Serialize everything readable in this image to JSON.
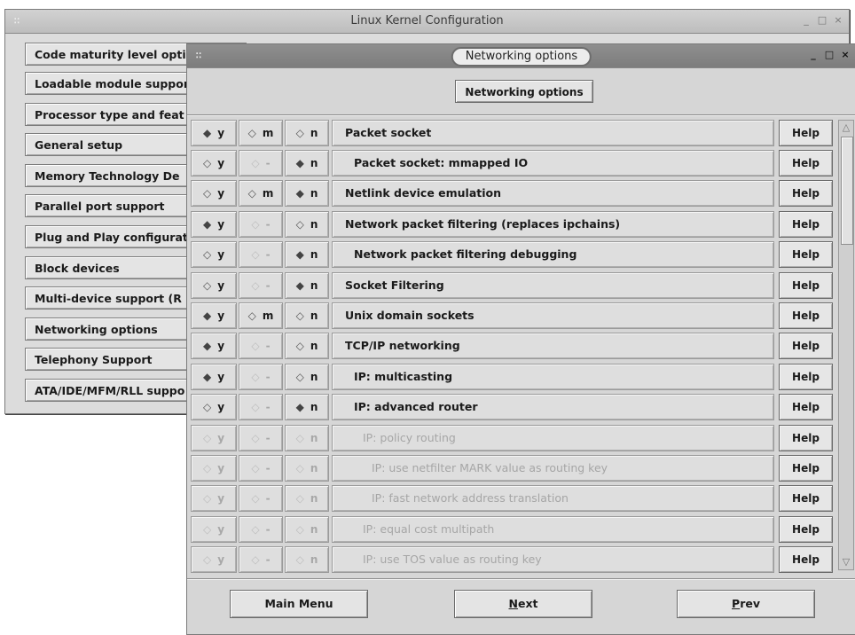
{
  "main_window": {
    "title": "Linux Kernel Configuration",
    "menu_glyph": "∷",
    "controls": [
      "_",
      "□",
      "×"
    ],
    "menu_items": [
      "Code maturity level opti",
      "Loadable module suppor",
      "Processor type and feat",
      "General setup",
      "Memory Technology De",
      "Parallel port support",
      "Plug and Play configurat",
      "Block devices",
      "Multi-device support (R",
      "Networking options",
      "Telephony Support",
      "ATA/IDE/MFM/RLL suppo"
    ]
  },
  "dialog": {
    "title": "Networking options",
    "menu_glyph": "∷",
    "controls": [
      "_",
      "□",
      "×"
    ],
    "header_button": "Networking options",
    "radio_glyph": "◆",
    "help_label": "Help",
    "options": [
      {
        "label": "Packet socket",
        "y": "y",
        "m": "m",
        "n": "n",
        "selected": "y",
        "m_available": true,
        "enabled": true,
        "indent": 0
      },
      {
        "label": "Packet socket: mmapped IO",
        "y": "y",
        "m": "-",
        "n": "n",
        "selected": "n",
        "m_available": false,
        "enabled": true,
        "indent": 1
      },
      {
        "label": "Netlink device emulation",
        "y": "y",
        "m": "m",
        "n": "n",
        "selected": "n",
        "m_available": true,
        "enabled": true,
        "indent": 0
      },
      {
        "label": "Network packet filtering (replaces ipchains)",
        "y": "y",
        "m": "-",
        "n": "n",
        "selected": "y",
        "m_available": false,
        "enabled": true,
        "indent": 0
      },
      {
        "label": "Network packet filtering debugging",
        "y": "y",
        "m": "-",
        "n": "n",
        "selected": "n",
        "m_available": false,
        "enabled": true,
        "indent": 1
      },
      {
        "label": "Socket Filtering",
        "y": "y",
        "m": "-",
        "n": "n",
        "selected": "n",
        "m_available": false,
        "enabled": true,
        "indent": 0
      },
      {
        "label": "Unix domain sockets",
        "y": "y",
        "m": "m",
        "n": "n",
        "selected": "y",
        "m_available": true,
        "enabled": true,
        "indent": 0
      },
      {
        "label": "TCP/IP networking",
        "y": "y",
        "m": "-",
        "n": "n",
        "selected": "y",
        "m_available": false,
        "enabled": true,
        "indent": 0
      },
      {
        "label": "IP: multicasting",
        "y": "y",
        "m": "-",
        "n": "n",
        "selected": "y",
        "m_available": false,
        "enabled": true,
        "indent": 1
      },
      {
        "label": "IP: advanced router",
        "y": "y",
        "m": "-",
        "n": "n",
        "selected": "n",
        "m_available": false,
        "enabled": true,
        "indent": 1
      },
      {
        "label": "IP: policy routing",
        "y": "y",
        "m": "-",
        "n": "n",
        "selected": "",
        "m_available": false,
        "enabled": false,
        "indent": 2
      },
      {
        "label": "IP: use netfilter MARK value as routing key",
        "y": "y",
        "m": "-",
        "n": "n",
        "selected": "",
        "m_available": false,
        "enabled": false,
        "indent": 3
      },
      {
        "label": "IP: fast network address translation",
        "y": "y",
        "m": "-",
        "n": "n",
        "selected": "",
        "m_available": false,
        "enabled": false,
        "indent": 3
      },
      {
        "label": "IP: equal cost multipath",
        "y": "y",
        "m": "-",
        "n": "n",
        "selected": "",
        "m_available": false,
        "enabled": false,
        "indent": 2
      },
      {
        "label": "IP: use TOS value as routing key",
        "y": "y",
        "m": "-",
        "n": "n",
        "selected": "",
        "m_available": false,
        "enabled": false,
        "indent": 2
      }
    ],
    "scroll_up": "△",
    "scroll_down": "▽",
    "buttons": {
      "main_menu": "Main Menu",
      "next_accel": "N",
      "next_rest": "ext",
      "prev_accel": "P",
      "prev_rest": "rev"
    }
  }
}
